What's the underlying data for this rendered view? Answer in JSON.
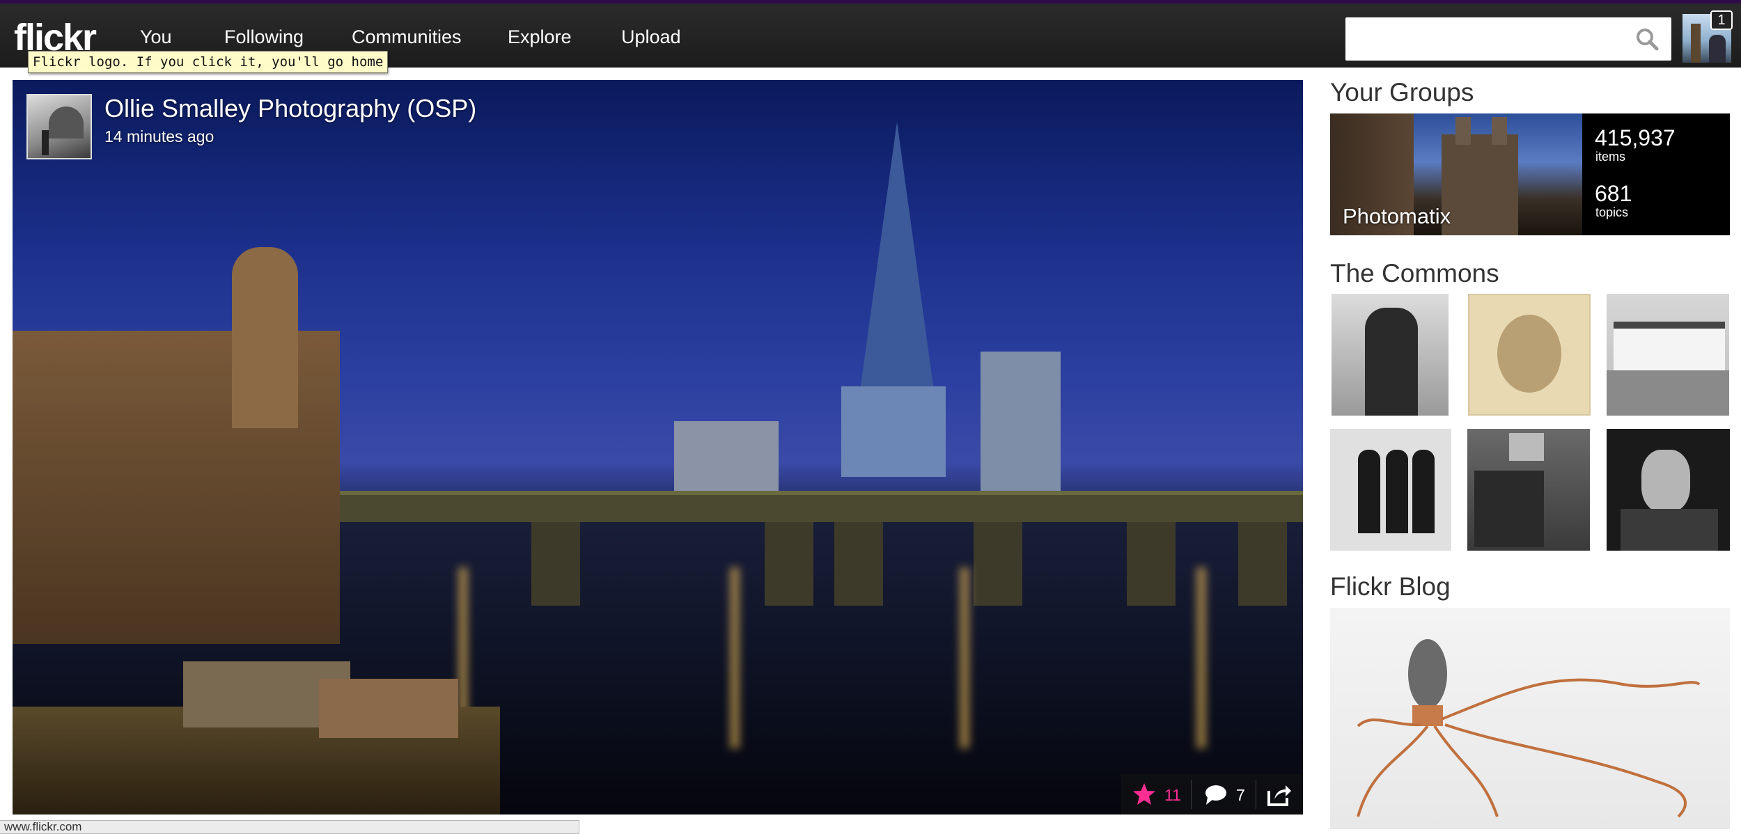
{
  "nav": {
    "logo": "flickr",
    "items": [
      "You",
      "Following",
      "Communities",
      "Explore",
      "Upload"
    ],
    "tooltip": "Flickr logo. If you click it, you'll go home",
    "search_placeholder": "",
    "notifications": "1"
  },
  "photo": {
    "owner": "Ollie Smalley Photography (OSP)",
    "time": "14 minutes ago",
    "favorites": "11",
    "comments": "7"
  },
  "sidebar": {
    "groups_title": "Your Groups",
    "group": {
      "name": "Photomatix",
      "items_count": "415,937",
      "items_label": "items",
      "topics_count": "681",
      "topics_label": "topics"
    },
    "commons_title": "The Commons",
    "blog_title": "Flickr Blog"
  },
  "status_bar": {
    "url": "www.flickr.com"
  },
  "colors": {
    "nav_bg": "#1c1c1c",
    "accent_pink": "#ff2e92",
    "top_line": "#2d0a4a"
  },
  "icons": [
    "search-icon",
    "star-icon",
    "comment-icon",
    "share-icon"
  ]
}
